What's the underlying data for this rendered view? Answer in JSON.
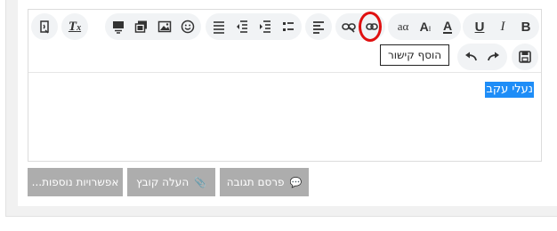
{
  "editor": {
    "content_text": "נעלי עקב",
    "tooltip": "הוסף קישור"
  },
  "toolbar": {
    "row1": [
      {
        "id": "bold",
        "label": "B",
        "icon": "bold-icon"
      },
      {
        "id": "italic",
        "label": "I",
        "icon": "italic-icon"
      },
      {
        "id": "underline",
        "label": "U",
        "icon": "underline-icon"
      },
      {
        "id": "font-color",
        "label": "A",
        "icon": "font-color-icon"
      },
      {
        "id": "font-size",
        "label": "A",
        "icon": "font-size-icon"
      },
      {
        "id": "font-family",
        "label": "aα",
        "icon": "font-family-icon"
      },
      {
        "id": "insert-link",
        "icon": "link-icon"
      },
      {
        "id": "remove-link",
        "icon": "unlink-icon"
      },
      {
        "id": "align",
        "icon": "align-left-icon"
      },
      {
        "id": "list",
        "icon": "list-icon"
      },
      {
        "id": "indent",
        "icon": "indent-icon"
      },
      {
        "id": "outdent",
        "icon": "outdent-icon"
      },
      {
        "id": "emoji",
        "icon": "smiley-icon"
      },
      {
        "id": "image",
        "icon": "image-icon"
      },
      {
        "id": "media",
        "icon": "media-icon"
      },
      {
        "id": "quote",
        "icon": "quote-icon"
      },
      {
        "id": "clear-format",
        "label": "T",
        "icon": "clear-format-icon"
      },
      {
        "id": "toggle-bbcode",
        "icon": "toggle-bbcode-icon"
      }
    ],
    "row2": [
      {
        "id": "save",
        "icon": "save-icon"
      },
      {
        "id": "redo",
        "icon": "redo-icon"
      },
      {
        "id": "undo",
        "icon": "undo-icon"
      }
    ]
  },
  "actions": {
    "post_reply": "פרסם תגובה",
    "upload_file": "העלה קובץ",
    "more_options": "אפשרויות נוספות..."
  }
}
